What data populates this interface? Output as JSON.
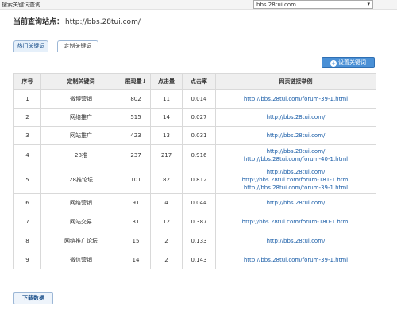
{
  "topbar": {
    "title": "搜索关键词查询",
    "site_value": "bbs.28tui.com",
    "arrow": "▾"
  },
  "current": {
    "label": "当前查询站点：",
    "value": "http://bbs.28tui.com/"
  },
  "tabs": {
    "hot": "热门关键词",
    "custom": "定制关键词"
  },
  "set_button": {
    "icon": "+",
    "label": "设置关键词"
  },
  "table": {
    "headers": [
      "序号",
      "定制关键词",
      "展现量↓",
      "点击量",
      "点击率",
      "网页链接举例"
    ],
    "rows": [
      {
        "no": "1",
        "keyword": "微博营销",
        "views": "802",
        "clicks": "11",
        "rate": "0.014",
        "links": [
          "http://bbs.28tui.com/forum-39-1.html"
        ]
      },
      {
        "no": "2",
        "keyword": "网络推广",
        "views": "515",
        "clicks": "14",
        "rate": "0.027",
        "links": [
          "http://bbs.28tui.com/"
        ]
      },
      {
        "no": "3",
        "keyword": "网站推广",
        "views": "423",
        "clicks": "13",
        "rate": "0.031",
        "links": [
          "http://bbs.28tui.com/"
        ]
      },
      {
        "no": "4",
        "keyword": "28推",
        "views": "237",
        "clicks": "217",
        "rate": "0.916",
        "links": [
          "http://bbs.28tui.com/",
          "http://bbs.28tui.com/forum-40-1.html"
        ]
      },
      {
        "no": "5",
        "keyword": "28推论坛",
        "views": "101",
        "clicks": "82",
        "rate": "0.812",
        "links": [
          "http://bbs.28tui.com/",
          "http://bbs.28tui.com/forum-181-1.html",
          "http://bbs.28tui.com/forum-39-1.html"
        ]
      },
      {
        "no": "6",
        "keyword": "网络营销",
        "views": "91",
        "clicks": "4",
        "rate": "0.044",
        "links": [
          "http://bbs.28tui.com/"
        ]
      },
      {
        "no": "7",
        "keyword": "网站交易",
        "views": "31",
        "clicks": "12",
        "rate": "0.387",
        "links": [
          "http://bbs.28tui.com/forum-180-1.html"
        ]
      },
      {
        "no": "8",
        "keyword": "网络推广论坛",
        "views": "15",
        "clicks": "2",
        "rate": "0.133",
        "links": [
          "http://bbs.28tui.com/"
        ]
      },
      {
        "no": "9",
        "keyword": "微信营销",
        "views": "14",
        "clicks": "2",
        "rate": "0.143",
        "links": [
          "http://bbs.28tui.com/forum-39-1.html"
        ]
      }
    ]
  },
  "download_button": {
    "label": "下载数据"
  }
}
